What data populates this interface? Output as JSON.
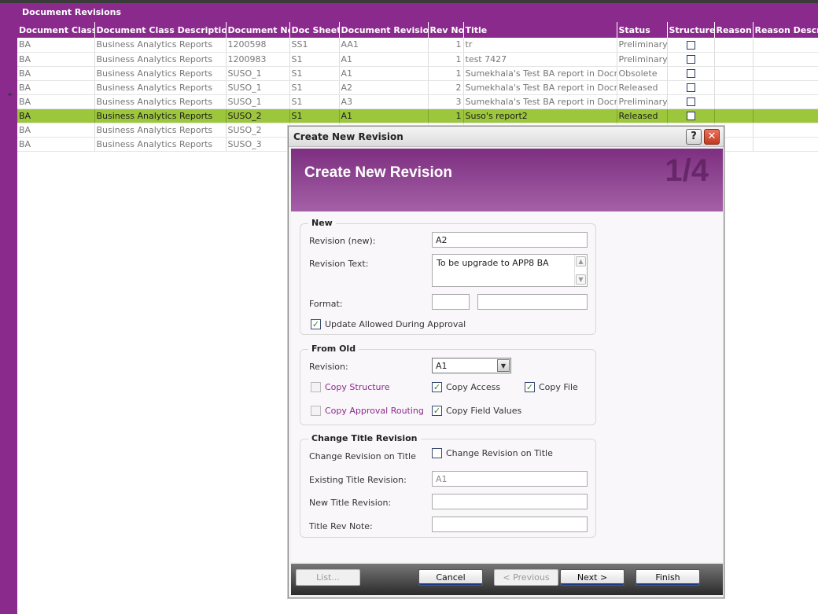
{
  "page": {
    "title": "Document Revisions"
  },
  "grid": {
    "columns": [
      "Document Class",
      "Document Class Description",
      "Document No",
      "Doc Sheet",
      "Document Revision",
      "Rev No",
      "Title",
      "Status",
      "Structure",
      "Reason",
      "Reason Descrip"
    ],
    "rows": [
      {
        "doc_class": "BA",
        "desc": "Business Analytics Reports",
        "doc_no": "1200598",
        "sheet": "SS1",
        "revision": "AA1",
        "rev_no": "1",
        "title": "tr",
        "status": "Preliminary",
        "structure": true,
        "selected": false
      },
      {
        "doc_class": "BA",
        "desc": "Business Analytics Reports",
        "doc_no": "1200983",
        "sheet": "S1",
        "revision": "A1",
        "rev_no": "1",
        "title": "test 7427",
        "status": "Preliminary",
        "structure": true,
        "selected": false
      },
      {
        "doc_class": "BA",
        "desc": "Business Analytics Reports",
        "doc_no": "SUSO_1",
        "sheet": "S1",
        "revision": "A1",
        "rev_no": "1",
        "title": "Sumekhala's Test BA report in Docman",
        "status": "Obsolete",
        "structure": true,
        "selected": false
      },
      {
        "doc_class": "BA",
        "desc": "Business Analytics Reports",
        "doc_no": "SUSO_1",
        "sheet": "S1",
        "revision": "A2",
        "rev_no": "2",
        "title": "Sumekhala's Test BA report in Docman",
        "status": "Released",
        "structure": true,
        "selected": false
      },
      {
        "doc_class": "BA",
        "desc": "Business Analytics Reports",
        "doc_no": "SUSO_1",
        "sheet": "S1",
        "revision": "A3",
        "rev_no": "3",
        "title": "Sumekhala's Test BA report in Docman",
        "status": "Preliminary",
        "structure": true,
        "selected": false
      },
      {
        "doc_class": "BA",
        "desc": "Business Analytics Reports",
        "doc_no": "SUSO_2",
        "sheet": "S1",
        "revision": "A1",
        "rev_no": "1",
        "title": "Suso's report2",
        "status": "Released",
        "structure": true,
        "selected": true
      },
      {
        "doc_class": "BA",
        "desc": "Business Analytics Reports",
        "doc_no": "SUSO_2",
        "sheet": "",
        "revision": "",
        "rev_no": "",
        "title": "",
        "status": "",
        "structure": false,
        "selected": false
      },
      {
        "doc_class": "BA",
        "desc": "Business Analytics Reports",
        "doc_no": "SUSO_3",
        "sheet": "",
        "revision": "",
        "rev_no": "",
        "title": "",
        "status": "",
        "structure": false,
        "selected": false
      }
    ]
  },
  "dialog": {
    "window_title": "Create New Revision",
    "banner_title": "Create New Revision",
    "step": "1/4",
    "new_group": {
      "legend": "New",
      "revision_label": "Revision (new):",
      "revision_value": "A2",
      "revision_text_label": "Revision Text:",
      "revision_text_value": "To be upgrade to APP8 BA",
      "format_label": "Format:",
      "format_value_1": "",
      "format_value_2": "",
      "update_allowed_label": "Update Allowed During Approval",
      "update_allowed_checked": true
    },
    "from_old_group": {
      "legend": "From Old",
      "revision_label": "Revision:",
      "revision_value": "A1",
      "copy_structure_label": "Copy Structure",
      "copy_access_label": "Copy Access",
      "copy_file_label": "Copy File",
      "copy_approval_routing_label": "Copy Approval Routing",
      "copy_field_values_label": "Copy Field Values"
    },
    "title_group": {
      "legend": "Change Title Revision",
      "change_rev_label": "Change Revision on Title",
      "change_rev_checkbox_label": "Change Revision on Title",
      "existing_label": "Existing Title Revision:",
      "existing_value": "A1",
      "new_label": "New Title Revision:",
      "new_value": "",
      "note_label": "Title Rev Note:",
      "note_value": ""
    },
    "footer": {
      "list_label": "List...",
      "cancel_label": "Cancel",
      "previous_label": "< Previous",
      "next_label": "Next >",
      "finish_label": "Finish"
    }
  }
}
